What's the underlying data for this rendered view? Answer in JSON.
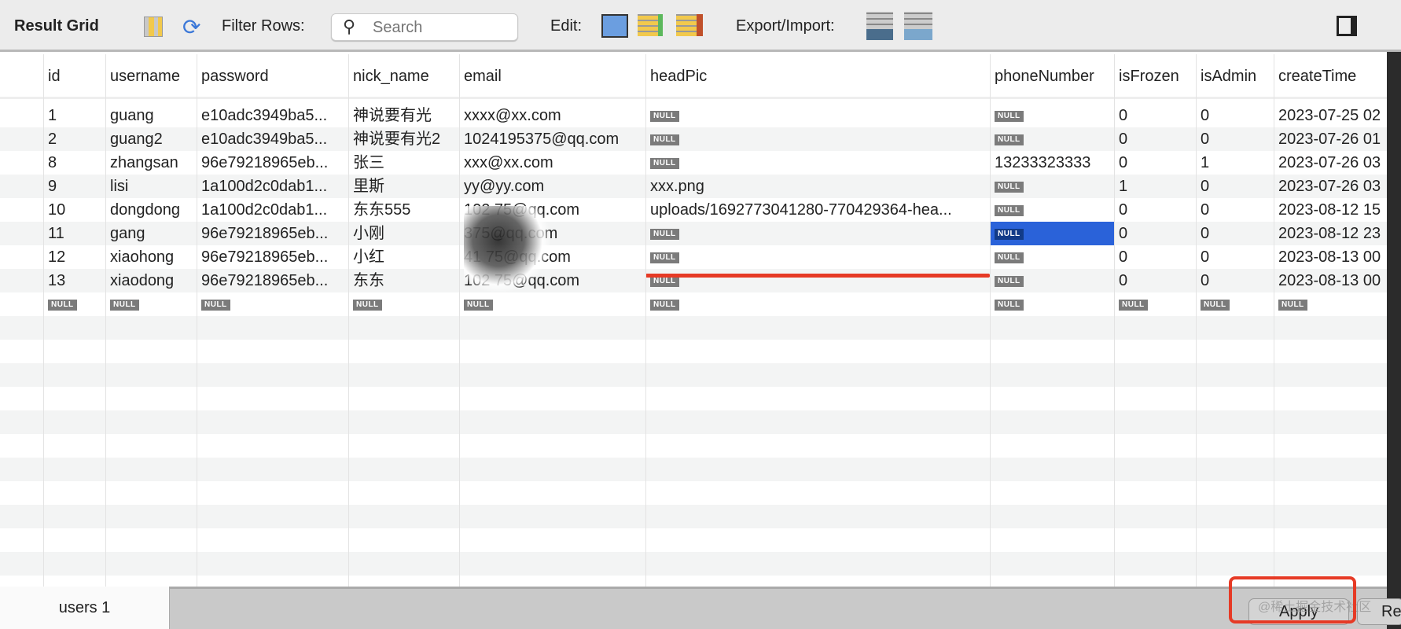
{
  "toolbar": {
    "title": "Result Grid",
    "filter_label": "Filter Rows:",
    "search_placeholder": "Search",
    "edit_label": "Edit:",
    "export_label": "Export/Import:"
  },
  "columns": [
    "id",
    "username",
    "password",
    "nick_name",
    "email",
    "headPic",
    "phoneNumber",
    "isFrozen",
    "isAdmin",
    "createTime"
  ],
  "null_label": "NULL",
  "rows": [
    [
      "1",
      "guang",
      "e10adc3949ba5...",
      "神说要有光",
      "xxxx@xx.com",
      null,
      null,
      "0",
      "0",
      "2023-07-25 02"
    ],
    [
      "2",
      "guang2",
      "e10adc3949ba5...",
      "神说要有光2",
      "1024195375@qq.com",
      null,
      null,
      "0",
      "0",
      "2023-07-26 01"
    ],
    [
      "8",
      "zhangsan",
      "96e79218965eb...",
      "张三",
      "xxx@xx.com",
      null,
      "13233323333",
      "0",
      "1",
      "2023-07-26 03"
    ],
    [
      "9",
      "lisi",
      "1a100d2c0dab1...",
      "里斯",
      "yy@yy.com",
      "xxx.png",
      null,
      "1",
      "0",
      "2023-07-26 03"
    ],
    [
      "10",
      "dongdong",
      "1a100d2c0dab1...",
      "东东555",
      "102    75@qq.com",
      "uploads/1692773041280-770429364-hea...",
      null,
      "0",
      "0",
      "2023-08-12 15"
    ],
    [
      "11",
      "gang",
      "96e79218965eb...",
      "小刚",
      "     375@qq.com",
      null,
      null,
      "0",
      "0",
      "2023-08-12 23"
    ],
    [
      "12",
      "xiaohong",
      "96e79218965eb...",
      "小红",
      "   41   75@qq.com",
      null,
      null,
      "0",
      "0",
      "2023-08-13 00"
    ],
    [
      "13",
      "xiaodong",
      "96e79218965eb...",
      "东东",
      "102     75@qq.com",
      null,
      null,
      "0",
      "0",
      "2023-08-13 00"
    ]
  ],
  "selected_cell": {
    "row": 5,
    "column": "phoneNumber"
  },
  "bottom": {
    "tab_label": "users 1",
    "apply_label": "Apply",
    "revert_label": "Re",
    "watermark": "@稀土掘金技术社区"
  },
  "colors": {
    "selection": "#2a62d9",
    "highlight": "#e63a25"
  }
}
